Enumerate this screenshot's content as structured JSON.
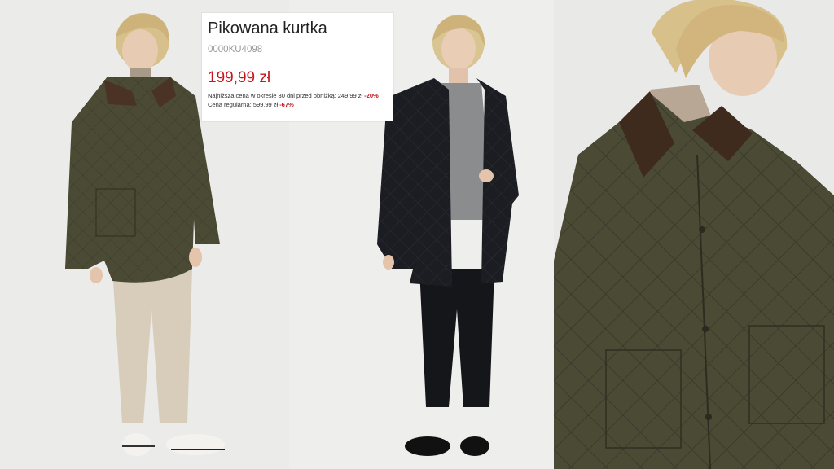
{
  "product": {
    "name": "Pikowana kurtka",
    "sku": "0000KU4098",
    "price": "199,99 zł",
    "lowest_price_label": "Najniższa cena w okresie 30 dni przed obniżką: 249,99 zł",
    "lowest_price_discount": "-20%",
    "regular_price_label": "Cena regularna: 599,99 zł",
    "regular_price_discount": "-67%"
  },
  "colors": {
    "price_red": "#c4161c",
    "jacket_olive": "#4b4a35",
    "jacket_black": "#1c1d22",
    "background": "#ececea"
  },
  "images": [
    {
      "name": "model-olive-jacket-full"
    },
    {
      "name": "model-black-jacket-full"
    },
    {
      "name": "model-olive-jacket-closeup"
    }
  ]
}
